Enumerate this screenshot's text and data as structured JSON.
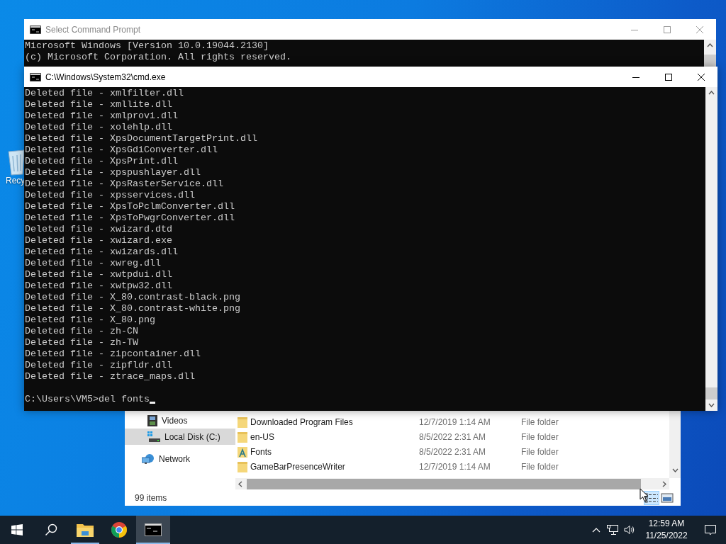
{
  "desktop": {
    "icons": [
      {
        "label": "Recy"
      }
    ]
  },
  "windows": [
    {
      "title": "Select Command Prompt",
      "active": false,
      "lines": [
        "Microsoft Windows [Version 10.0.19044.2130]",
        "(c) Microsoft Corporation. All rights reserved."
      ]
    },
    {
      "title": "C:\\Windows\\System32\\cmd.exe",
      "active": true,
      "lines": [
        "Deleted file - xmlfilter.dll",
        "Deleted file - xmllite.dll",
        "Deleted file - xmlprovi.dll",
        "Deleted file - xolehlp.dll",
        "Deleted file - XpsDocumentTargetPrint.dll",
        "Deleted file - XpsGdiConverter.dll",
        "Deleted file - XpsPrint.dll",
        "Deleted file - xpspushlayer.dll",
        "Deleted file - XpsRasterService.dll",
        "Deleted file - xpsservices.dll",
        "Deleted file - XpsToPclmConverter.dll",
        "Deleted file - XpsToPwgrConverter.dll",
        "Deleted file - xwizard.dtd",
        "Deleted file - xwizard.exe",
        "Deleted file - xwizards.dll",
        "Deleted file - xwreg.dll",
        "Deleted file - xwtpdui.dll",
        "Deleted file - xwtpw32.dll",
        "Deleted file - X_80.contrast-black.png",
        "Deleted file - X_80.contrast-white.png",
        "Deleted file - X_80.png",
        "Deleted file - zh-CN",
        "Deleted file - zh-TW",
        "Deleted file - zipcontainer.dll",
        "Deleted file - zipfldr.dll",
        "Deleted file - ztrace_maps.dll"
      ],
      "prompt": "C:\\Users\\VM5>del fonts"
    }
  ],
  "explorer": {
    "nav_items": [
      {
        "kind": "videos",
        "label": "Videos",
        "selected": false
      },
      {
        "kind": "drive",
        "label": "Local Disk (C:)",
        "selected": true
      },
      {
        "kind": "network",
        "label": "Network",
        "selected": false
      }
    ],
    "rows": [
      {
        "kind": "folder",
        "name": "Downloaded Program Files",
        "date_modified": "12/7/2019 1:14 AM",
        "type": "File folder"
      },
      {
        "kind": "folder",
        "name": "en-US",
        "date_modified": "8/5/2022 2:31 AM",
        "type": "File folder"
      },
      {
        "kind": "fonts",
        "name": "Fonts",
        "date_modified": "8/5/2022 2:31 AM",
        "type": "File folder"
      },
      {
        "kind": "folder",
        "name": "GameBarPresenceWriter",
        "date_modified": "12/7/2019 1:14 AM",
        "type": "File folder"
      }
    ],
    "status": "99 items",
    "views": [
      {
        "kind": "details",
        "selected": true
      },
      {
        "kind": "large",
        "selected": false
      }
    ]
  },
  "taskbar": {
    "apps": [
      {
        "kind": "explorer",
        "running": true,
        "selected": false
      },
      {
        "kind": "chrome",
        "running": false,
        "selected": false
      },
      {
        "kind": "console",
        "running": true,
        "selected": true
      }
    ],
    "time": "12:59 AM",
    "date": "11/25/2022"
  }
}
